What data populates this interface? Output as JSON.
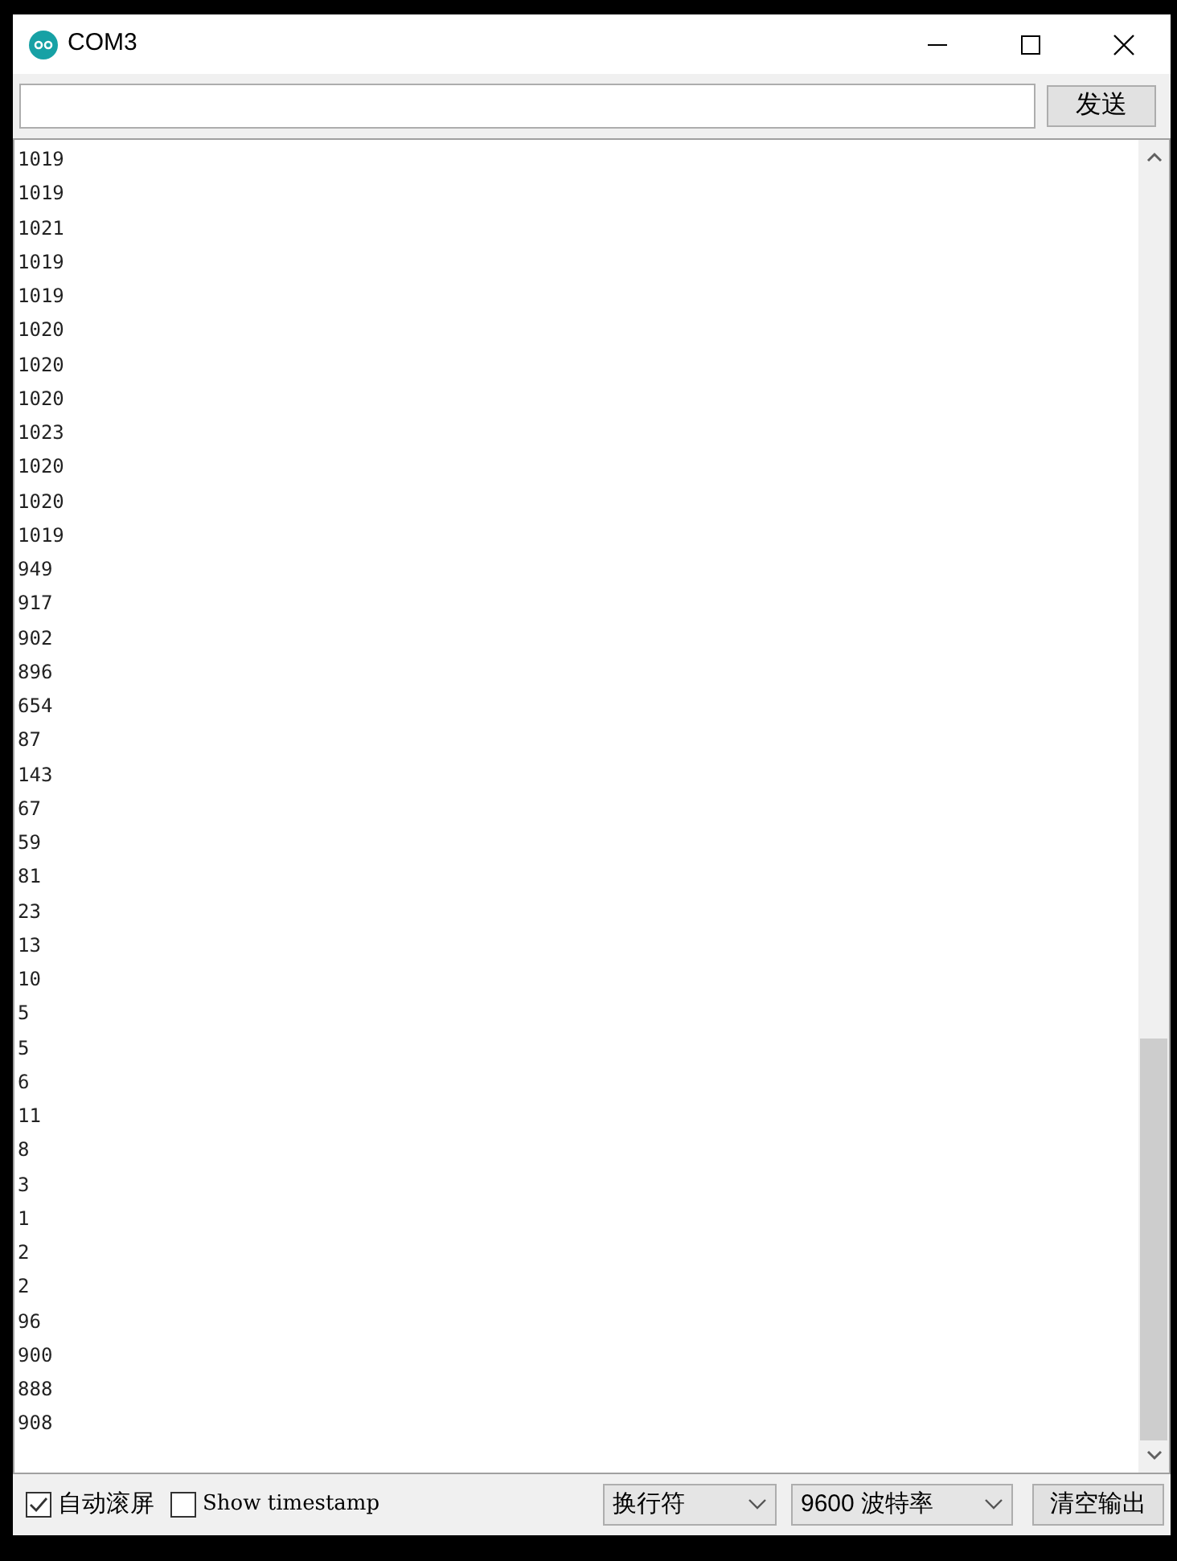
{
  "window": {
    "title": "COM3"
  },
  "send": {
    "button": "发送"
  },
  "output": {
    "lines": [
      "1019",
      "1019",
      "1021",
      "1019",
      "1019",
      "1020",
      "1020",
      "1020",
      "1023",
      "1020",
      "1020",
      "1019",
      "949",
      "917",
      "902",
      "896",
      "654",
      "87",
      "143",
      "67",
      "59",
      "81",
      "23",
      "13",
      "10",
      "5",
      "5",
      "6",
      "11",
      "8",
      "3",
      "1",
      "2",
      "2",
      "96",
      "900",
      "888",
      "908"
    ]
  },
  "footer": {
    "options": [
      {
        "label": "自动滚屏",
        "checked": true
      },
      {
        "label": "Show timestamp",
        "checked": false
      }
    ],
    "dropdowns": [
      {
        "value": "换行符"
      },
      {
        "value": "9600 波特率"
      }
    ],
    "clear_button": "清空输出"
  }
}
